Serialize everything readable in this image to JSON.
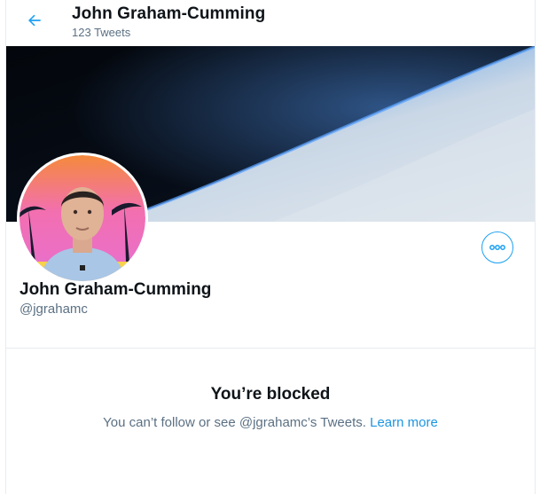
{
  "header": {
    "title": "John Graham-Cumming",
    "subtitle": "123 Tweets",
    "back_icon": "arrow-left-icon"
  },
  "profile": {
    "name": "John Graham-Cumming",
    "handle": "@jgrahamc",
    "more_icon": "more-horizontal-icon"
  },
  "blocked": {
    "title": "You’re blocked",
    "message": "You can’t follow or see @jgrahamc’s Tweets.",
    "link": "Learn more"
  },
  "colors": {
    "accent": "#1da1f2",
    "link": "#1b95e0",
    "secondary_text": "#5b7083",
    "divider": "#e6ecf0"
  }
}
